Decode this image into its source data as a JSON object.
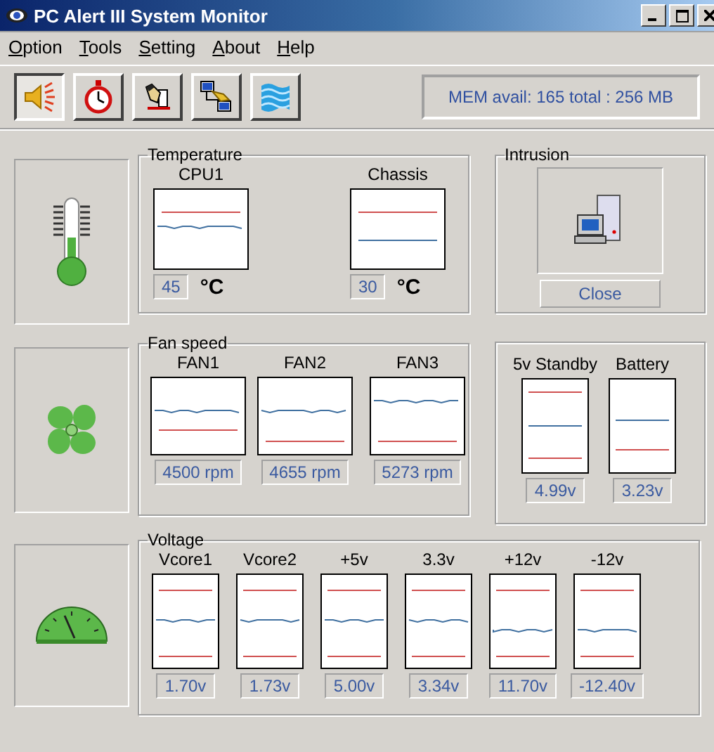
{
  "window": {
    "title": "PC Alert III System Monitor"
  },
  "menu": [
    {
      "label": "Option"
    },
    {
      "label": "Tools"
    },
    {
      "label": "Setting"
    },
    {
      "label": "About"
    },
    {
      "label": "Help"
    }
  ],
  "toolbar": [
    {
      "kind": "speaker",
      "selected": true
    },
    {
      "kind": "stopwatch",
      "selected": false
    },
    {
      "kind": "hand",
      "selected": false
    },
    {
      "kind": "network",
      "selected": false
    },
    {
      "kind": "waves",
      "selected": false
    }
  ],
  "memory": "MEM avail: 165  total : 256 MB",
  "temperature": {
    "title": "Temperature",
    "sensors": [
      {
        "label": "CPU1",
        "reading": "45",
        "unit": "°C"
      },
      {
        "label": "Chassis",
        "reading": "30",
        "unit": "°C"
      }
    ]
  },
  "intrusion": {
    "title": "Intrusion",
    "button": "Close"
  },
  "fan_speed": {
    "title": "Fan speed",
    "sensors": [
      {
        "label": "FAN1",
        "reading": "4500 rpm"
      },
      {
        "label": "FAN2",
        "reading": "4655 rpm"
      },
      {
        "label": "FAN3",
        "reading": "5273 rpm"
      }
    ]
  },
  "standby": {
    "sensors": [
      {
        "label": "5v Standby",
        "reading": "4.99v"
      },
      {
        "label": "Battery",
        "reading": "3.23v"
      }
    ]
  },
  "voltage": {
    "title": "Voltage",
    "sensors": [
      {
        "label": "Vcore1",
        "reading": "1.70v"
      },
      {
        "label": "Vcore2",
        "reading": "1.73v"
      },
      {
        "label": "+5v",
        "reading": "5.00v"
      },
      {
        "label": "3.3v",
        "reading": "3.34v"
      },
      {
        "label": "+12v",
        "reading": "11.70v"
      },
      {
        "label": "-12v",
        "reading": "-12.40v"
      }
    ]
  }
}
